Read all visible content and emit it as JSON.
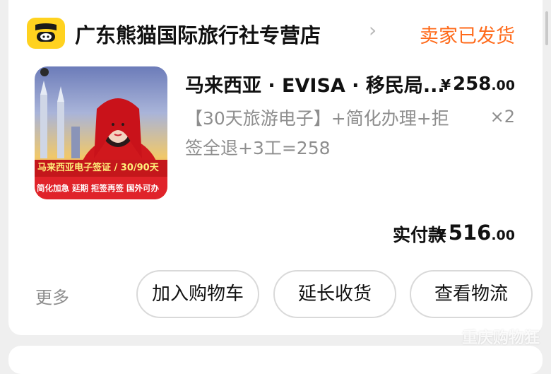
{
  "shop": {
    "name": "广东熊猫国际旅行社专营店",
    "logo_icon": "fliggy-pig-logo"
  },
  "order": {
    "status": "卖家已发货",
    "product": {
      "title": "马来西亚 · EVISA · 移民局...",
      "sku": "【30天旅游电子】+简化办理+拒签全退+3工=258",
      "price_symbol": "¥",
      "price_int": "258",
      "price_dec": ".00",
      "quantity": "×2",
      "thumbnail": {
        "banner_title": "马来西亚电子签证 / 30/90天",
        "banner_features": "简化加急 延期 拒签再签 国外可办"
      }
    },
    "total_label": "实付款",
    "total_symbol": "¥",
    "total_int": "516",
    "total_dec": ".00"
  },
  "actions": {
    "more": "更多",
    "add_to_cart": "加入购物车",
    "extend_receipt": "延长收货",
    "view_logistics": "查看物流"
  },
  "watermark": "重庆购物狂",
  "colors": {
    "status_orange": "#ff6a1a",
    "logo_yellow": "#ffd21f",
    "muted_gray": "#8e8e8e"
  }
}
